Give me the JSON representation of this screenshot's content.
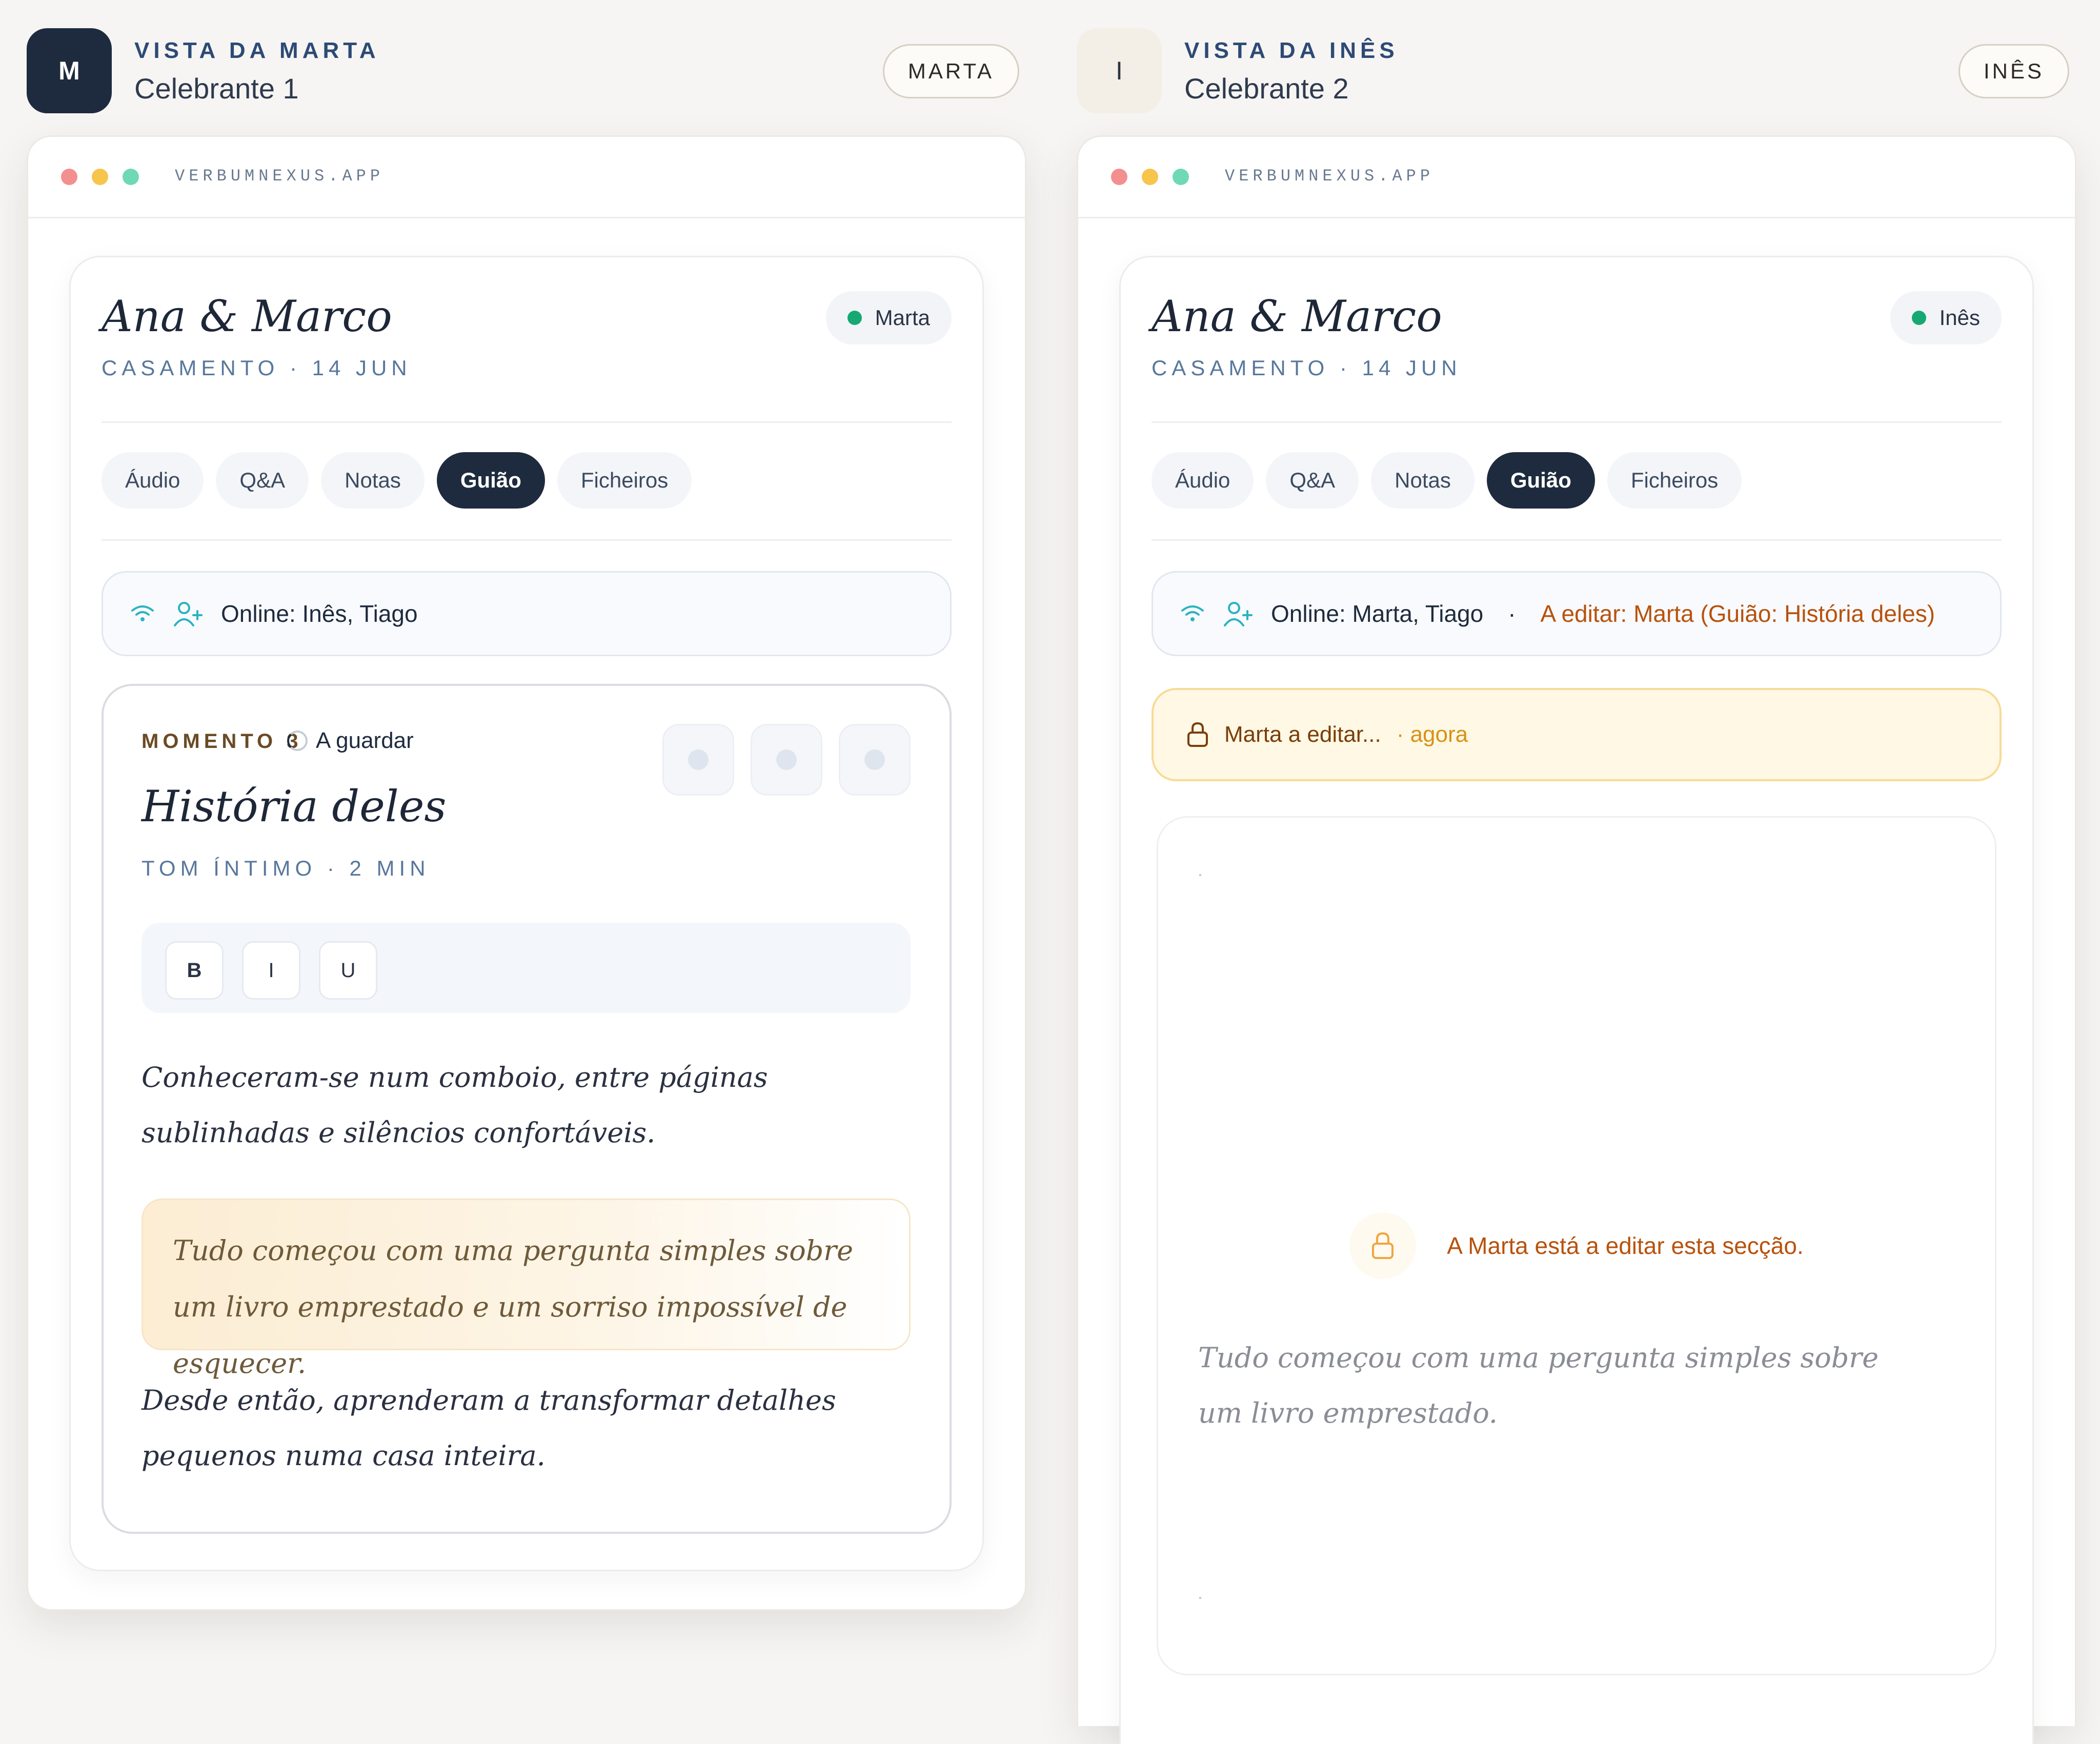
{
  "colors": {
    "accent_dark": "#1e2b3e",
    "online_green": "#17a874",
    "editing_orange": "#b8520c",
    "lock_amber": "#d89116"
  },
  "left": {
    "avatar_letter": "M",
    "kicker": "VISTA DA MARTA",
    "role": "Celebrante 1",
    "name_pill": "MARTA",
    "url": "VERBUMNEXUS.APP",
    "couple": "Ana & Marco",
    "event": "CASAMENTO · 14 JUN",
    "presence": "Marta",
    "tabs": [
      "Áudio",
      "Q&A",
      "Notas",
      "Guião",
      "Ficheiros"
    ],
    "active_tab": "Guião",
    "online": "Online: Inês, Tiago",
    "editor": {
      "moment": "MOMENTO 3",
      "saving": "A guardar",
      "title": "História deles",
      "tone": "TOM ÍNTIMO · 2 MIN",
      "format": {
        "bold": "B",
        "italic": "I",
        "underline": "U"
      },
      "p1": "Conheceram-se num comboio, entre páginas sublinhadas e silêncios confortáveis.",
      "quote": "Tudo começou com uma pergunta simples sobre um livro emprestado e um sorriso impossível de esquecer.",
      "p3": "Desde então, aprenderam a transformar detalhes pequenos numa casa inteira."
    }
  },
  "right": {
    "avatar_letter": "I",
    "kicker": "VISTA DA INÊS",
    "role": "Celebrante 2",
    "name_pill": "INÊS",
    "url": "VERBUMNEXUS.APP",
    "couple": "Ana & Marco",
    "event": "CASAMENTO · 14 JUN",
    "presence": "Inês",
    "tabs": [
      "Áudio",
      "Q&A",
      "Notas",
      "Guião",
      "Ficheiros"
    ],
    "active_tab": "Guião",
    "online": "Online: Marta, Tiago",
    "online_sep": "·",
    "editing": "A editar: Marta (Guião: História deles)",
    "lock_banner": {
      "who": "Marta a editar...",
      "when": "· agora"
    },
    "locked_message": "A Marta está a editar esta secção.",
    "preview": "Tudo começou com uma pergunta simples sobre um livro emprestado."
  }
}
